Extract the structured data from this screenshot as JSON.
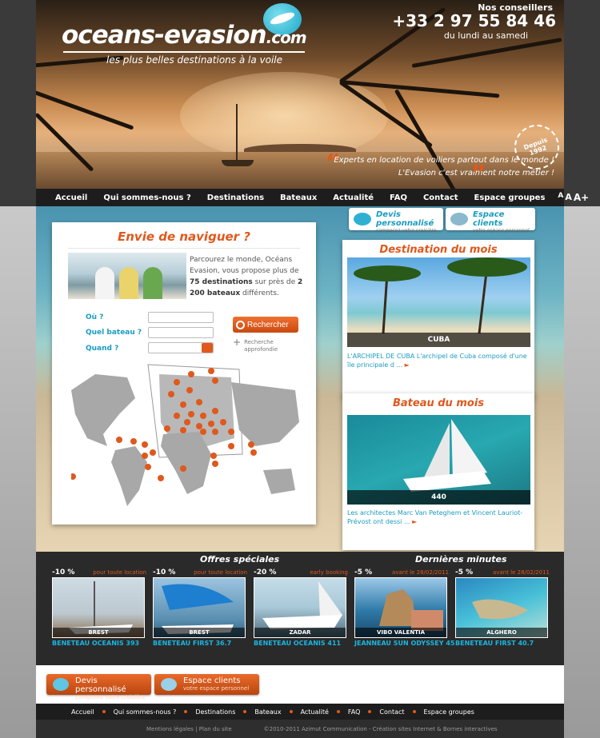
{
  "header": {
    "logo_main": "oceans-evasion",
    "logo_tld": ".com",
    "tagline": "les plus belles destinations à la voile",
    "phone_label": "Nos conseillers",
    "phone": "+33 2 97 55 84 46",
    "phone_hours": "du lundi au samedi",
    "badge": "Depuis 1992",
    "quote_line1": "Experts en location de voiliers partout dans le monde !",
    "quote_line2": "L'Evasion c'est vraiment notre métier !"
  },
  "nav": {
    "items": [
      "Accueil",
      "Qui sommes-nous ?",
      "Destinations",
      "Bateaux",
      "Actualité",
      "FAQ",
      "Contact",
      "Espace groupes"
    ],
    "font_small": "A",
    "font_medium": "A",
    "font_large": "A+"
  },
  "top_buttons": {
    "devis_title": "Devis personnalisé",
    "devis_sub": "composez votre croisière",
    "clients_title": "Espace clients",
    "clients_sub": "votre espace personnel"
  },
  "search": {
    "title": "Envie de naviguer ?",
    "intro_text1": "Parcourez le monde, Océans Evasion, vous propose plus de ",
    "intro_bold1": "75 destinations",
    "intro_text2": " sur près de ",
    "intro_bold2": "2 200 bateaux",
    "intro_text3": " différents.",
    "label_where": "Où ?",
    "label_boat": "Quel bateau ?",
    "label_when": "Quand ?",
    "button": "Rechercher",
    "advanced": "Recherche approfondie"
  },
  "destination": {
    "title": "Destination du mois",
    "caption": "CUBA",
    "desc": "L'ARCHIPEL DE CUBA L'archipel de Cuba composé d'une île principale d ...",
    "arrow": "►"
  },
  "boat": {
    "title": "Bateau du mois",
    "caption": "440",
    "desc": "Les architectes Marc Van Peteghem et Vincent Lauriot-Prévost ont dessi ...",
    "arrow": "►"
  },
  "offers": {
    "special_title": "Offres spéciales",
    "last_title": "Dernières minutes",
    "items": [
      {
        "pct": "-10 %",
        "cond": "pour toute location",
        "place": "BREST",
        "model": "BENETEAU OCEANIS 393"
      },
      {
        "pct": "-10 %",
        "cond": "pour toute location",
        "place": "BREST",
        "model": "BENETEAU FIRST 36.7"
      },
      {
        "pct": "-20 %",
        "cond": "early booking",
        "place": "ZADAR",
        "model": "BENETEAU OCEANIS 411"
      },
      {
        "pct": "-5 %",
        "cond": "avant le 28/02/2011",
        "place": "VIBO VALENTIA",
        "model": "JEANNEAU SUN ODYSSEY 45"
      },
      {
        "pct": "-5 %",
        "cond": "avant le 28/02/2011",
        "place": "ALGHERO",
        "model": "BENETEAU FIRST 40.7"
      }
    ]
  },
  "bottom_buttons": {
    "devis_title": "Devis personnalisé",
    "devis_sub": "composez votre croisière",
    "clients_title": "Espace clients",
    "clients_sub": "votre espace personnel"
  },
  "footer": {
    "nav": [
      "Accueil",
      "Qui sommes-nous ?",
      "Destinations",
      "Bateaux",
      "Actualité",
      "FAQ",
      "Contact",
      "Espace groupes"
    ],
    "legal": "Mentions légales | Plan du site",
    "copyright": "©2010-2011 Azimut Communication - Création sites Internet & Bornes interactives"
  },
  "colors": {
    "accent": "#e0581c",
    "link": "#1a9cc0",
    "nav_bg": "#1d1d1d"
  }
}
